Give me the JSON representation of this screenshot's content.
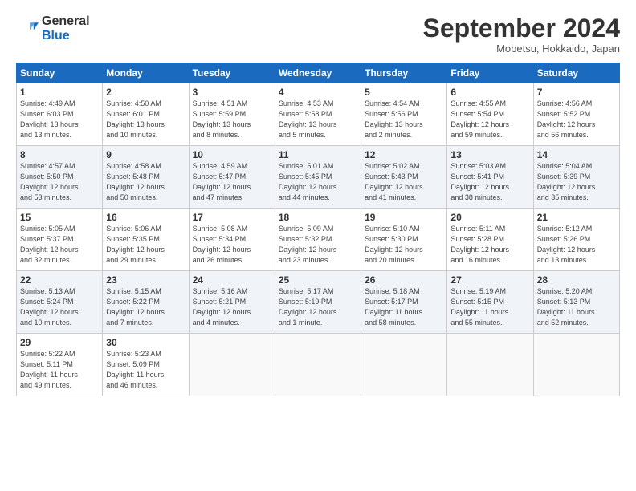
{
  "logo": {
    "general": "General",
    "blue": "Blue"
  },
  "title": "September 2024",
  "location": "Mobetsu, Hokkaido, Japan",
  "headers": [
    "Sunday",
    "Monday",
    "Tuesday",
    "Wednesday",
    "Thursday",
    "Friday",
    "Saturday"
  ],
  "weeks": [
    [
      {
        "day": "1",
        "info": "Sunrise: 4:49 AM\nSunset: 6:03 PM\nDaylight: 13 hours\nand 13 minutes."
      },
      {
        "day": "2",
        "info": "Sunrise: 4:50 AM\nSunset: 6:01 PM\nDaylight: 13 hours\nand 10 minutes."
      },
      {
        "day": "3",
        "info": "Sunrise: 4:51 AM\nSunset: 5:59 PM\nDaylight: 13 hours\nand 8 minutes."
      },
      {
        "day": "4",
        "info": "Sunrise: 4:53 AM\nSunset: 5:58 PM\nDaylight: 13 hours\nand 5 minutes."
      },
      {
        "day": "5",
        "info": "Sunrise: 4:54 AM\nSunset: 5:56 PM\nDaylight: 13 hours\nand 2 minutes."
      },
      {
        "day": "6",
        "info": "Sunrise: 4:55 AM\nSunset: 5:54 PM\nDaylight: 12 hours\nand 59 minutes."
      },
      {
        "day": "7",
        "info": "Sunrise: 4:56 AM\nSunset: 5:52 PM\nDaylight: 12 hours\nand 56 minutes."
      }
    ],
    [
      {
        "day": "8",
        "info": "Sunrise: 4:57 AM\nSunset: 5:50 PM\nDaylight: 12 hours\nand 53 minutes."
      },
      {
        "day": "9",
        "info": "Sunrise: 4:58 AM\nSunset: 5:48 PM\nDaylight: 12 hours\nand 50 minutes."
      },
      {
        "day": "10",
        "info": "Sunrise: 4:59 AM\nSunset: 5:47 PM\nDaylight: 12 hours\nand 47 minutes."
      },
      {
        "day": "11",
        "info": "Sunrise: 5:01 AM\nSunset: 5:45 PM\nDaylight: 12 hours\nand 44 minutes."
      },
      {
        "day": "12",
        "info": "Sunrise: 5:02 AM\nSunset: 5:43 PM\nDaylight: 12 hours\nand 41 minutes."
      },
      {
        "day": "13",
        "info": "Sunrise: 5:03 AM\nSunset: 5:41 PM\nDaylight: 12 hours\nand 38 minutes."
      },
      {
        "day": "14",
        "info": "Sunrise: 5:04 AM\nSunset: 5:39 PM\nDaylight: 12 hours\nand 35 minutes."
      }
    ],
    [
      {
        "day": "15",
        "info": "Sunrise: 5:05 AM\nSunset: 5:37 PM\nDaylight: 12 hours\nand 32 minutes."
      },
      {
        "day": "16",
        "info": "Sunrise: 5:06 AM\nSunset: 5:35 PM\nDaylight: 12 hours\nand 29 minutes."
      },
      {
        "day": "17",
        "info": "Sunrise: 5:08 AM\nSunset: 5:34 PM\nDaylight: 12 hours\nand 26 minutes."
      },
      {
        "day": "18",
        "info": "Sunrise: 5:09 AM\nSunset: 5:32 PM\nDaylight: 12 hours\nand 23 minutes."
      },
      {
        "day": "19",
        "info": "Sunrise: 5:10 AM\nSunset: 5:30 PM\nDaylight: 12 hours\nand 20 minutes."
      },
      {
        "day": "20",
        "info": "Sunrise: 5:11 AM\nSunset: 5:28 PM\nDaylight: 12 hours\nand 16 minutes."
      },
      {
        "day": "21",
        "info": "Sunrise: 5:12 AM\nSunset: 5:26 PM\nDaylight: 12 hours\nand 13 minutes."
      }
    ],
    [
      {
        "day": "22",
        "info": "Sunrise: 5:13 AM\nSunset: 5:24 PM\nDaylight: 12 hours\nand 10 minutes."
      },
      {
        "day": "23",
        "info": "Sunrise: 5:15 AM\nSunset: 5:22 PM\nDaylight: 12 hours\nand 7 minutes."
      },
      {
        "day": "24",
        "info": "Sunrise: 5:16 AM\nSunset: 5:21 PM\nDaylight: 12 hours\nand 4 minutes."
      },
      {
        "day": "25",
        "info": "Sunrise: 5:17 AM\nSunset: 5:19 PM\nDaylight: 12 hours\nand 1 minute."
      },
      {
        "day": "26",
        "info": "Sunrise: 5:18 AM\nSunset: 5:17 PM\nDaylight: 11 hours\nand 58 minutes."
      },
      {
        "day": "27",
        "info": "Sunrise: 5:19 AM\nSunset: 5:15 PM\nDaylight: 11 hours\nand 55 minutes."
      },
      {
        "day": "28",
        "info": "Sunrise: 5:20 AM\nSunset: 5:13 PM\nDaylight: 11 hours\nand 52 minutes."
      }
    ],
    [
      {
        "day": "29",
        "info": "Sunrise: 5:22 AM\nSunset: 5:11 PM\nDaylight: 11 hours\nand 49 minutes."
      },
      {
        "day": "30",
        "info": "Sunrise: 5:23 AM\nSunset: 5:09 PM\nDaylight: 11 hours\nand 46 minutes."
      },
      null,
      null,
      null,
      null,
      null
    ]
  ]
}
